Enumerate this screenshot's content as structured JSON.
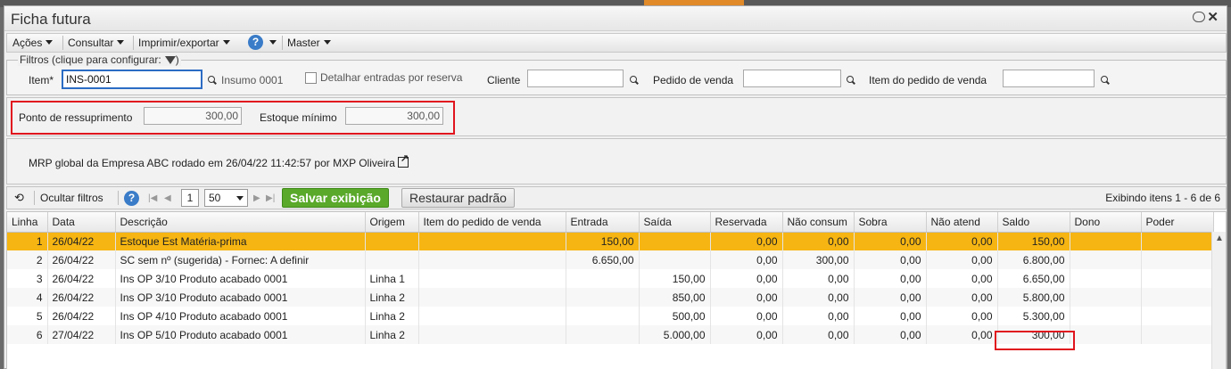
{
  "window": {
    "title": "Ficha futura"
  },
  "menu": {
    "acoes": "Ações",
    "consultar": "Consultar",
    "imprimir": "Imprimir/exportar",
    "master": "Master"
  },
  "filters": {
    "legend": "Filtros (clique para configurar:",
    "legend_end": ")",
    "item_label": "Item*",
    "item_value": "INS-0001",
    "item_desc": "Insumo 0001",
    "detalhar_label": "Detalhar entradas por reserva",
    "cliente_label": "Cliente",
    "cliente_value": "",
    "pedido_label": "Pedido de venda",
    "pedido_value": "",
    "item_pedido_label": "Item do pedido de venda",
    "item_pedido_value": ""
  },
  "params": {
    "ponto_label": "Ponto de ressuprimento",
    "ponto_value": "300,00",
    "estoque_label": "Estoque mínimo",
    "estoque_value": "300,00"
  },
  "mrp": {
    "text": "MRP global da Empresa ABC rodado em 26/04/22 11:42:57 por MXP Oliveira"
  },
  "toolbar": {
    "ocultar": "Ocultar filtros",
    "page": "1",
    "page_size": "50",
    "salvar": "Salvar exibição",
    "restaurar": "Restaurar padrão",
    "exibindo": "Exibindo itens 1 - 6 de 6"
  },
  "table": {
    "headers": [
      "Linha",
      "Data",
      "Descrição",
      "Origem",
      "Item do pedido de venda",
      "Entrada",
      "Saída",
      "Reservada",
      "Não consum",
      "Sobra",
      "Não atend",
      "Saldo",
      "Dono",
      "Poder"
    ],
    "rows": [
      [
        "1",
        "26/04/22",
        "Estoque Est Matéria-prima",
        "",
        "",
        "150,00",
        "",
        "0,00",
        "0,00",
        "0,00",
        "0,00",
        "150,00",
        "",
        ""
      ],
      [
        "2",
        "26/04/22",
        "SC sem nº (sugerida) - Fornec: A definir",
        "",
        "",
        "6.650,00",
        "",
        "0,00",
        "300,00",
        "0,00",
        "0,00",
        "6.800,00",
        "",
        ""
      ],
      [
        "3",
        "26/04/22",
        "Ins OP 3/10 Produto acabado 0001",
        "Linha 1",
        "",
        "",
        "150,00",
        "0,00",
        "0,00",
        "0,00",
        "0,00",
        "6.650,00",
        "",
        ""
      ],
      [
        "4",
        "26/04/22",
        "Ins OP 3/10 Produto acabado 0001",
        "Linha 2",
        "",
        "",
        "850,00",
        "0,00",
        "0,00",
        "0,00",
        "0,00",
        "5.800,00",
        "",
        ""
      ],
      [
        "5",
        "26/04/22",
        "Ins OP 4/10 Produto acabado 0001",
        "Linha 2",
        "",
        "",
        "500,00",
        "0,00",
        "0,00",
        "0,00",
        "0,00",
        "5.300,00",
        "",
        ""
      ],
      [
        "6",
        "27/04/22",
        "Ins OP 5/10 Produto acabado 0001",
        "Linha 2",
        "",
        "",
        "5.000,00",
        "0,00",
        "0,00",
        "0,00",
        "0,00",
        "300,00",
        "",
        ""
      ]
    ]
  },
  "colors": {
    "selected_row": "#f6b512",
    "highlight": "#e0141e",
    "save_button": "#5aa92a"
  }
}
